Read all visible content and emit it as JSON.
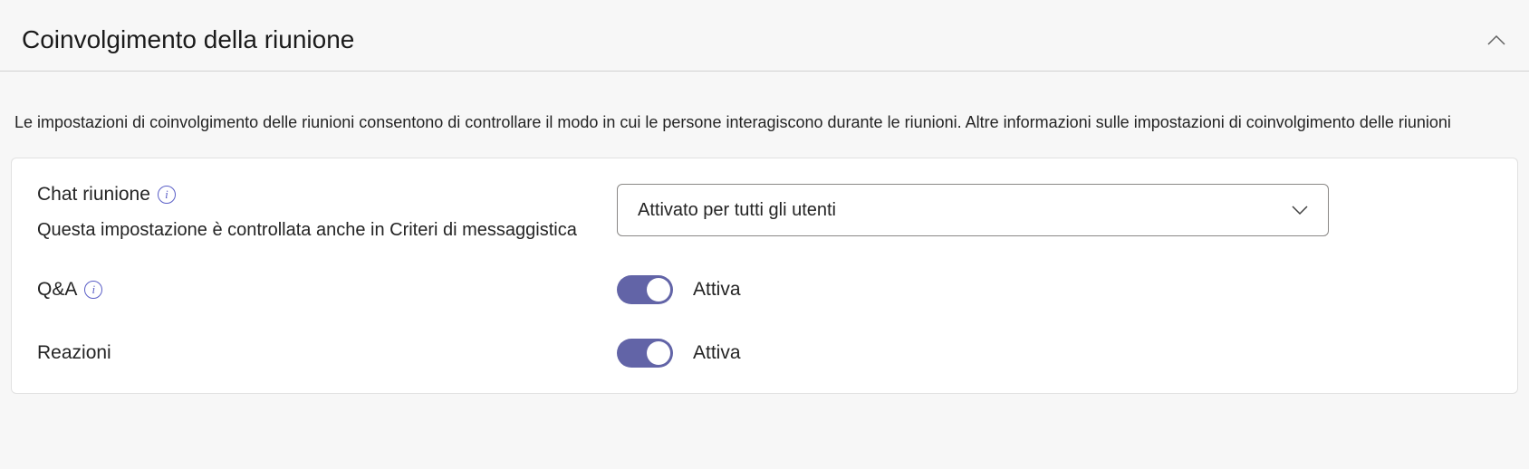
{
  "section": {
    "title": "Coinvolgimento della riunione",
    "description": "Le impostazioni di coinvolgimento delle riunioni consentono di controllare il modo in cui le persone interagiscono durante le riunioni. Altre informazioni sulle impostazioni di coinvolgimento delle riunioni"
  },
  "settings": {
    "chat": {
      "label": "Chat riunione",
      "sublabel": "Questa impostazione è controllata anche in Criteri di messaggistica",
      "dropdown_value": "Attivato per tutti gli utenti"
    },
    "qa": {
      "label": "Q&A",
      "toggle_state": "on",
      "toggle_label": "Attiva"
    },
    "reactions": {
      "label": "Reazioni",
      "toggle_state": "on",
      "toggle_label": "Attiva"
    }
  },
  "colors": {
    "toggle_on": "#6264a7",
    "info_accent": "#5b5fc7"
  }
}
